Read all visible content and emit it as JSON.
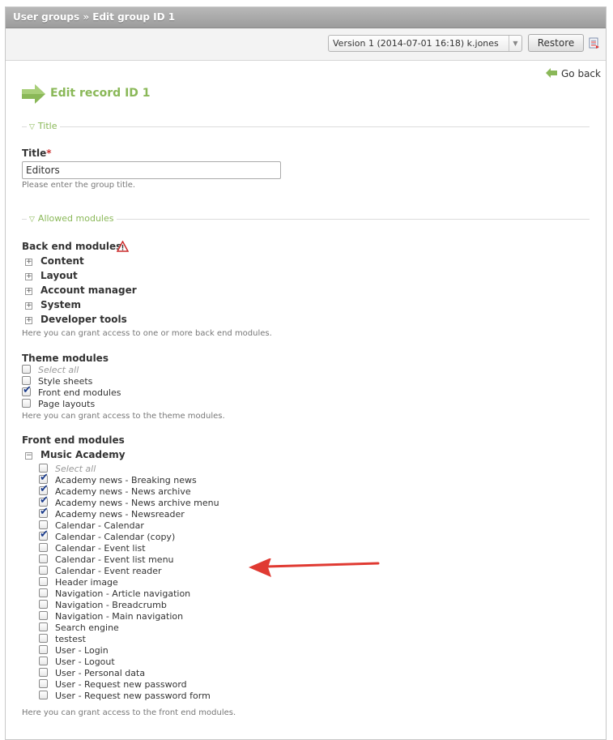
{
  "header": {
    "title": "User groups » Edit group ID 1"
  },
  "toolbar": {
    "version_selected": "Version 1 (2014-07-01 16:18) k.jones",
    "restore_label": "Restore"
  },
  "go_back_label": "Go back",
  "edit_title": "Edit record ID 1",
  "sections": {
    "title_legend": "Title",
    "modules_legend": "Allowed modules"
  },
  "title_field": {
    "label": "Title",
    "required_marker": "*",
    "value": "Editors",
    "help": "Please enter the group title."
  },
  "backend": {
    "label": "Back end modules",
    "items": [
      "Content",
      "Layout",
      "Account manager",
      "System",
      "Developer tools"
    ],
    "help": "Here you can grant access to one or more back end modules."
  },
  "theme": {
    "label": "Theme modules",
    "select_all": "Select all",
    "items": [
      {
        "label": "Style sheets",
        "checked": false
      },
      {
        "label": "Front end modules",
        "checked": true
      },
      {
        "label": "Page layouts",
        "checked": false
      }
    ],
    "help": "Here you can grant access to the theme modules."
  },
  "frontend": {
    "label": "Front end modules",
    "group": "Music Academy",
    "select_all": "Select all",
    "items": [
      {
        "label": "Academy news - Breaking news",
        "checked": true
      },
      {
        "label": "Academy news - News archive",
        "checked": true
      },
      {
        "label": "Academy news - News archive menu",
        "checked": true
      },
      {
        "label": "Academy news - Newsreader",
        "checked": true
      },
      {
        "label": "Calendar - Calendar",
        "checked": false
      },
      {
        "label": "Calendar - Calendar (copy)",
        "checked": true
      },
      {
        "label": "Calendar - Event list",
        "checked": false
      },
      {
        "label": "Calendar - Event list menu",
        "checked": false
      },
      {
        "label": "Calendar - Event reader",
        "checked": false
      },
      {
        "label": "Header image",
        "checked": false
      },
      {
        "label": "Navigation - Article navigation",
        "checked": false
      },
      {
        "label": "Navigation - Breadcrumb",
        "checked": false
      },
      {
        "label": "Navigation - Main navigation",
        "checked": false
      },
      {
        "label": "Search engine",
        "checked": false
      },
      {
        "label": "testest",
        "checked": false
      },
      {
        "label": "User - Login",
        "checked": false
      },
      {
        "label": "User - Logout",
        "checked": false
      },
      {
        "label": "User - Personal data",
        "checked": false
      },
      {
        "label": "User - Request new password",
        "checked": false
      },
      {
        "label": "User - Request new password form",
        "checked": false
      }
    ],
    "help": "Here you can grant access to the front end modules."
  },
  "colors": {
    "accent_green": "#8ab858",
    "arrow_red": "#e03a32",
    "check_blue": "#1c3d8c"
  }
}
